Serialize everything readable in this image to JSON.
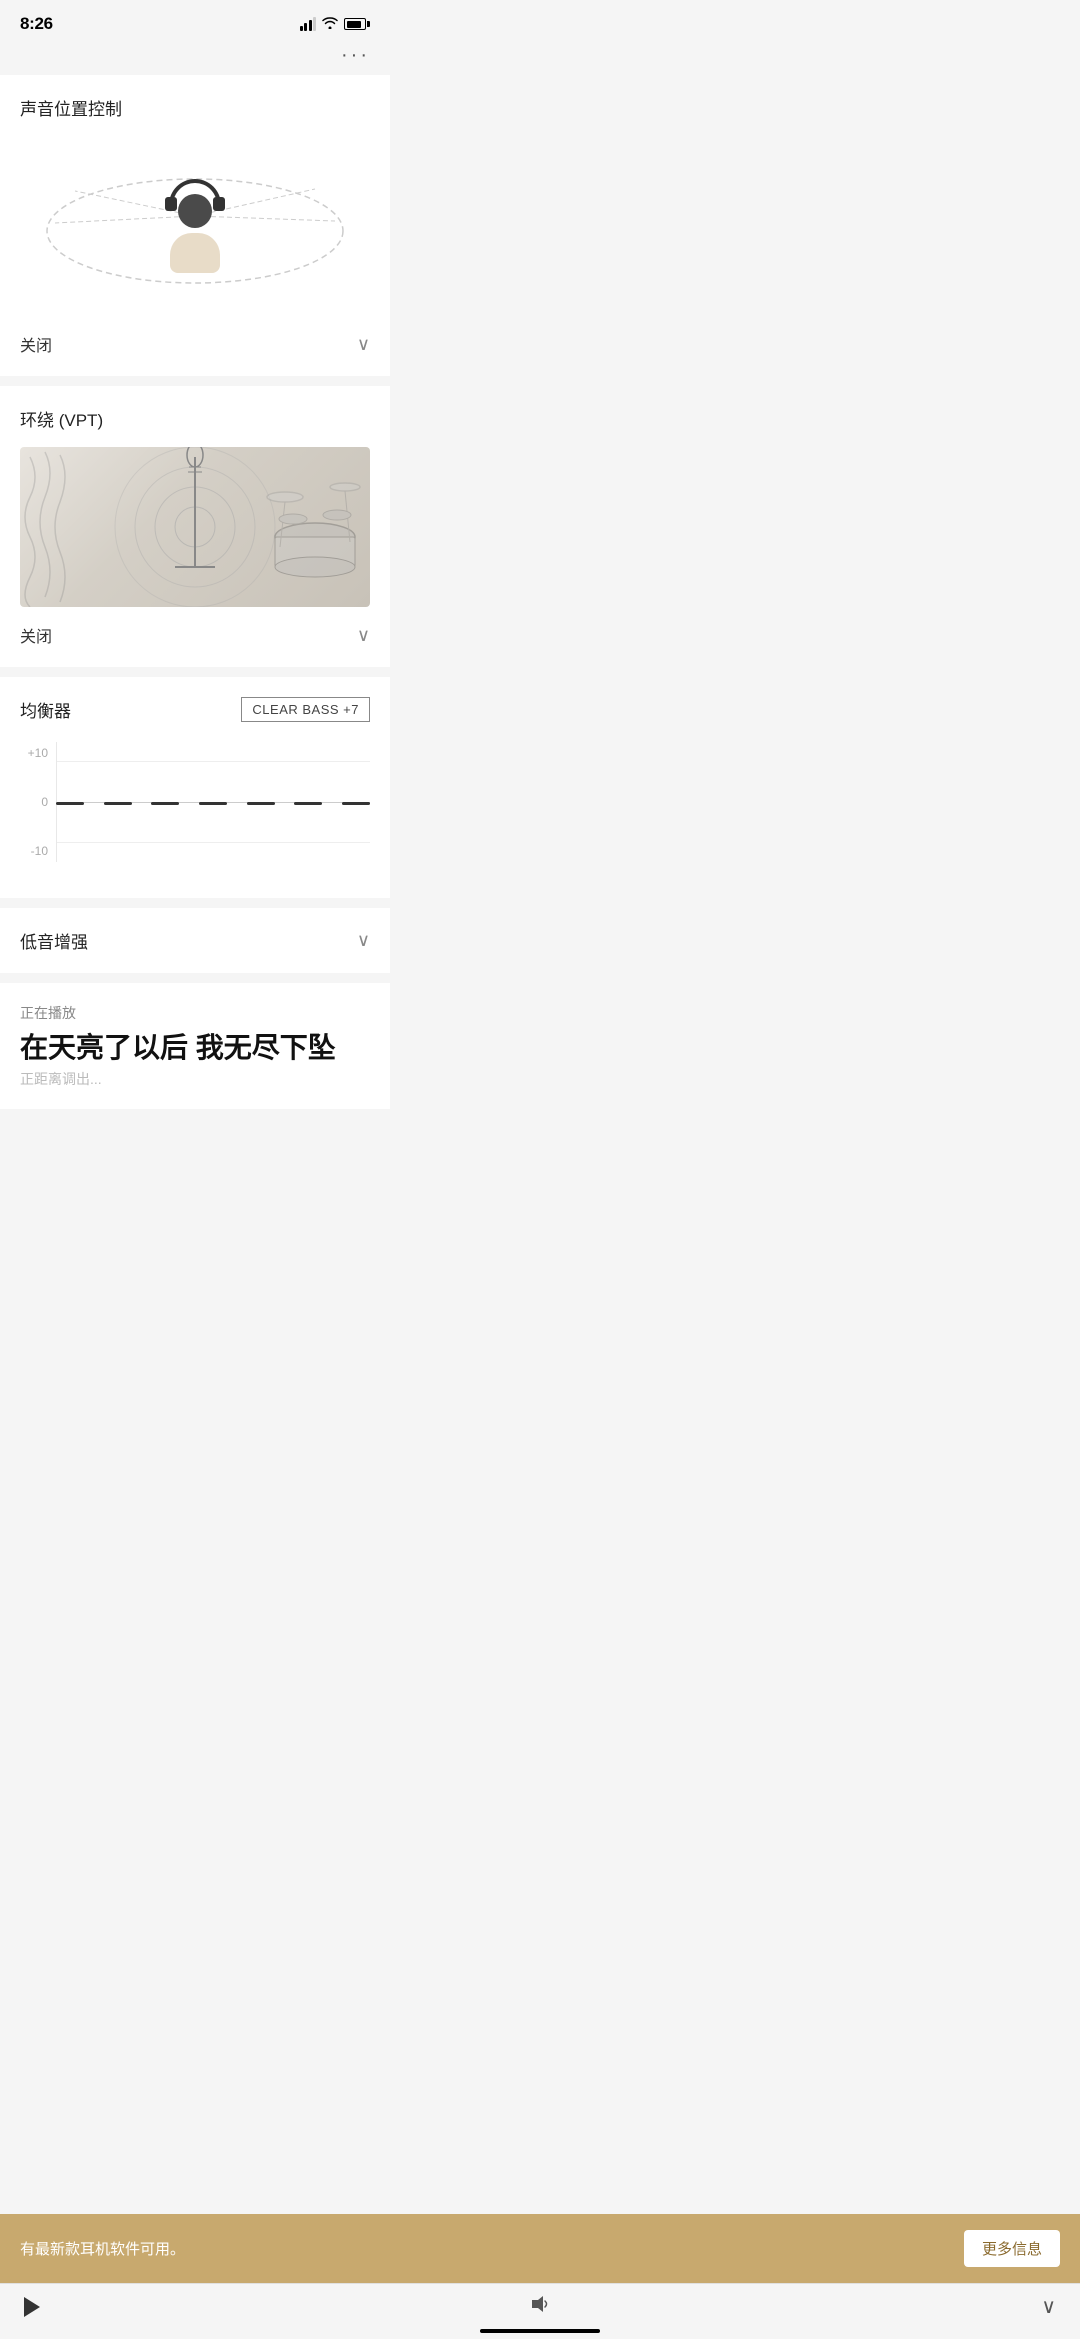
{
  "statusBar": {
    "time": "8:26",
    "locationArrow": "↗"
  },
  "menuDots": "···",
  "sections": {
    "soundPosition": {
      "title": "声音位置控制",
      "dropdownValue": "关闭"
    },
    "vpt": {
      "title": "环绕 (VPT)",
      "dropdownValue": "关闭"
    },
    "equalizer": {
      "title": "均衡器",
      "badge": "CLEAR BASS  +7",
      "yAxisLabels": [
        "+10",
        "0",
        "-10"
      ],
      "barCount": 7
    },
    "bassBoost": {
      "title": "低音增强"
    },
    "nowPlaying": {
      "label": "正在播放",
      "title": "在天亮了以后 我无尽下坠",
      "subtitle": "正距离调出..."
    }
  },
  "toast": {
    "message": "有最新款耳机软件可用。",
    "buttonLabel": "更多信息"
  },
  "bottomBar": {
    "playLabel": "play",
    "volumeLabel": "volume",
    "expandLabel": "expand"
  }
}
